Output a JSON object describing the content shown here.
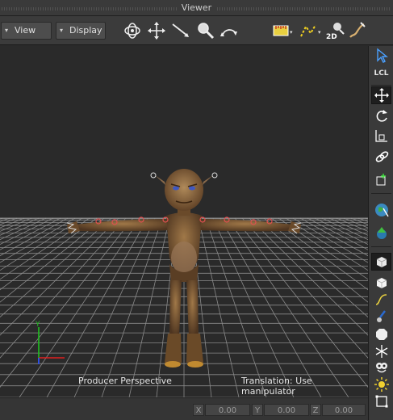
{
  "window": {
    "title": "Viewer"
  },
  "toolbar": {
    "view_label": "View",
    "display_label": "Display",
    "view_arrow": "▾",
    "display_arrow": "▾",
    "icons": [
      "orbit-icon",
      "pan-icon",
      "dolly-icon",
      "zoom-icon",
      "undo-view-icon",
      "ruler-icon",
      "path-icon",
      "2d-zoom-icon",
      "pencil-icon"
    ],
    "two_d_label": "2D"
  },
  "viewport": {
    "camera_label": "Producer Perspective",
    "status_label": "Translation: Use manipulator",
    "axis_y_label": "Y"
  },
  "side_toolbar": {
    "lcl_label": "LCL",
    "tools": [
      "select-icon",
      "local-space",
      "translate-icon",
      "rotate-icon",
      "scale-icon",
      "link-icon",
      "pivot-icon",
      "world-icon",
      "navigation-icon",
      "shaded-cube-icon",
      "cube-icon",
      "curve-icon",
      "brush-icon",
      "sphere-icon",
      "asterisk-icon",
      "eyes-icon",
      "light-icon",
      "frame-icon"
    ],
    "active_tools": [
      "translate-icon",
      "shaded-cube-icon"
    ]
  },
  "coordinates": {
    "x_label": "X",
    "x_value": "0.00",
    "y_label": "Y",
    "y_value": "0.00",
    "z_label": "Z",
    "z_value": "0.00"
  },
  "colors": {
    "background": "#2a2a2a",
    "grid": "#8a8a8a",
    "axis_x": "#e02020",
    "axis_y": "#20c020",
    "axis_z": "#3050e0",
    "skin": "#7a5a3a"
  }
}
